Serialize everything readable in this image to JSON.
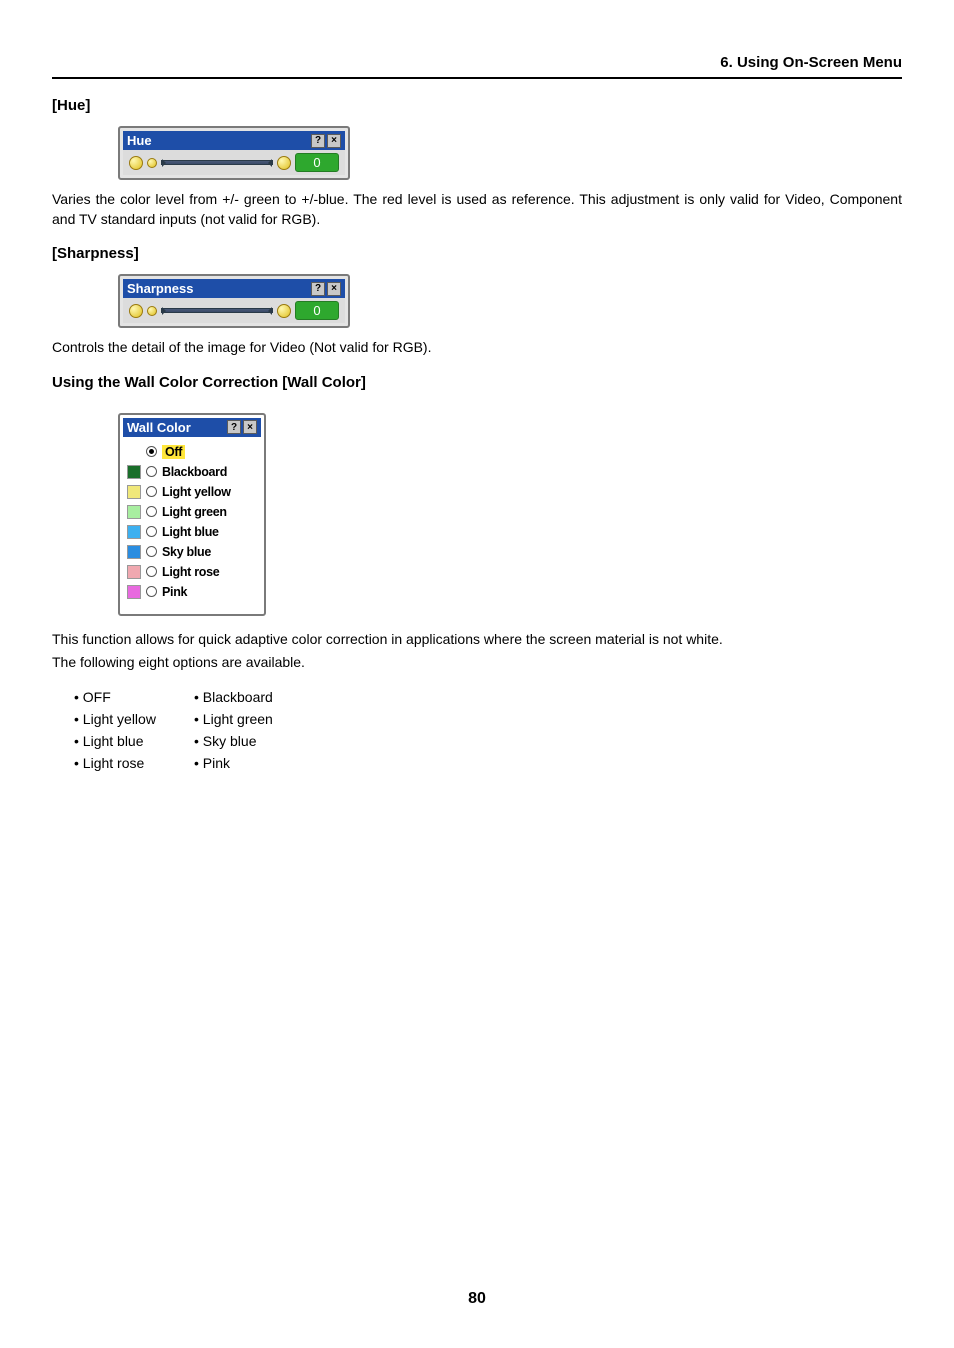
{
  "header": {
    "section_title": "6. Using On-Screen Menu"
  },
  "hue": {
    "heading": "[Hue]",
    "panel_title": "Hue",
    "value": "0",
    "description": "Varies the color level from +/- green to +/-blue. The red level is used as reference. This adjustment is only valid for Video, Component and TV standard inputs (not valid for RGB)."
  },
  "sharpness": {
    "heading": "[Sharpness]",
    "panel_title": "Sharpness",
    "value": "0",
    "description": "Controls the detail of the image for Video (Not valid for RGB)."
  },
  "wall_color": {
    "heading": "Using the Wall Color Correction [Wall Color]",
    "panel_title": "Wall Color",
    "options": [
      {
        "label": "Off",
        "swatch": "transparent",
        "selected": true,
        "highlighted": true
      },
      {
        "label": "Blackboard",
        "swatch": "#1a6e2a",
        "selected": false,
        "highlighted": false
      },
      {
        "label": "Light yellow",
        "swatch": "#f0e87a",
        "selected": false,
        "highlighted": false
      },
      {
        "label": "Light green",
        "swatch": "#a8eea0",
        "selected": false,
        "highlighted": false
      },
      {
        "label": "Light blue",
        "swatch": "#3db0f0",
        "selected": false,
        "highlighted": false
      },
      {
        "label": "Sky blue",
        "swatch": "#2a8de0",
        "selected": false,
        "highlighted": false
      },
      {
        "label": "Light rose",
        "swatch": "#f0a8b0",
        "selected": false,
        "highlighted": false
      },
      {
        "label": "Pink",
        "swatch": "#e86adf",
        "selected": false,
        "highlighted": false
      }
    ],
    "description_line1": "This function allows for quick adaptive color correction in applications where the screen material is not white.",
    "description_line2": "The following eight options are available.",
    "list_items": [
      "• OFF",
      "• Blackboard",
      "• Light yellow",
      "• Light green",
      "• Light blue",
      "• Sky blue",
      "• Light rose",
      "• Pink"
    ]
  },
  "page_number": "80",
  "icons": {
    "help": "?",
    "close": "×"
  }
}
